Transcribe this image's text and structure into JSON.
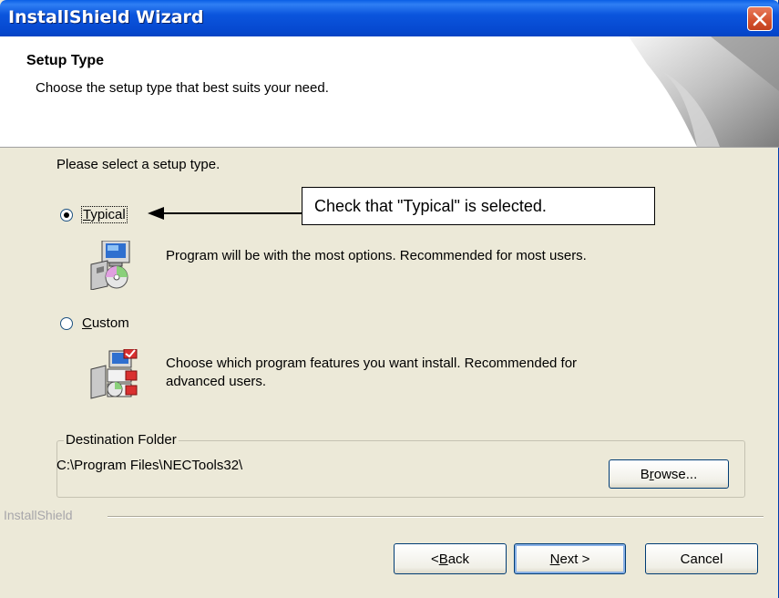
{
  "window": {
    "title": "InstallShield Wizard"
  },
  "header": {
    "title": "Setup Type",
    "subtitle": "Choose the setup type that best suits your need."
  },
  "body": {
    "prompt": "Please select a setup type.",
    "options": [
      {
        "label": "Typical",
        "mnemonic": "T",
        "rest": "ypical",
        "selected": true,
        "description": "Program will be with the most options. Recommended for most users."
      },
      {
        "label": "Custom",
        "mnemonic": "C",
        "rest": "ustom",
        "selected": false,
        "description_line1": "Choose which program features you want install. Recommended for",
        "description_line2": "advanced users."
      }
    ],
    "callout": "Check that \"Typical\" is selected."
  },
  "destination": {
    "legend": "Destination Folder",
    "path": "C:\\Program Files\\NECTools32\\",
    "browse_pre": "B",
    "browse_mnemonic": "r",
    "browse_post": "owse..."
  },
  "footer": {
    "brand": "InstallShield",
    "back_pre": "< ",
    "back_mnemonic": "B",
    "back_post": "ack",
    "next_mnemonic": "N",
    "next_post": "ext >",
    "cancel": "Cancel"
  }
}
